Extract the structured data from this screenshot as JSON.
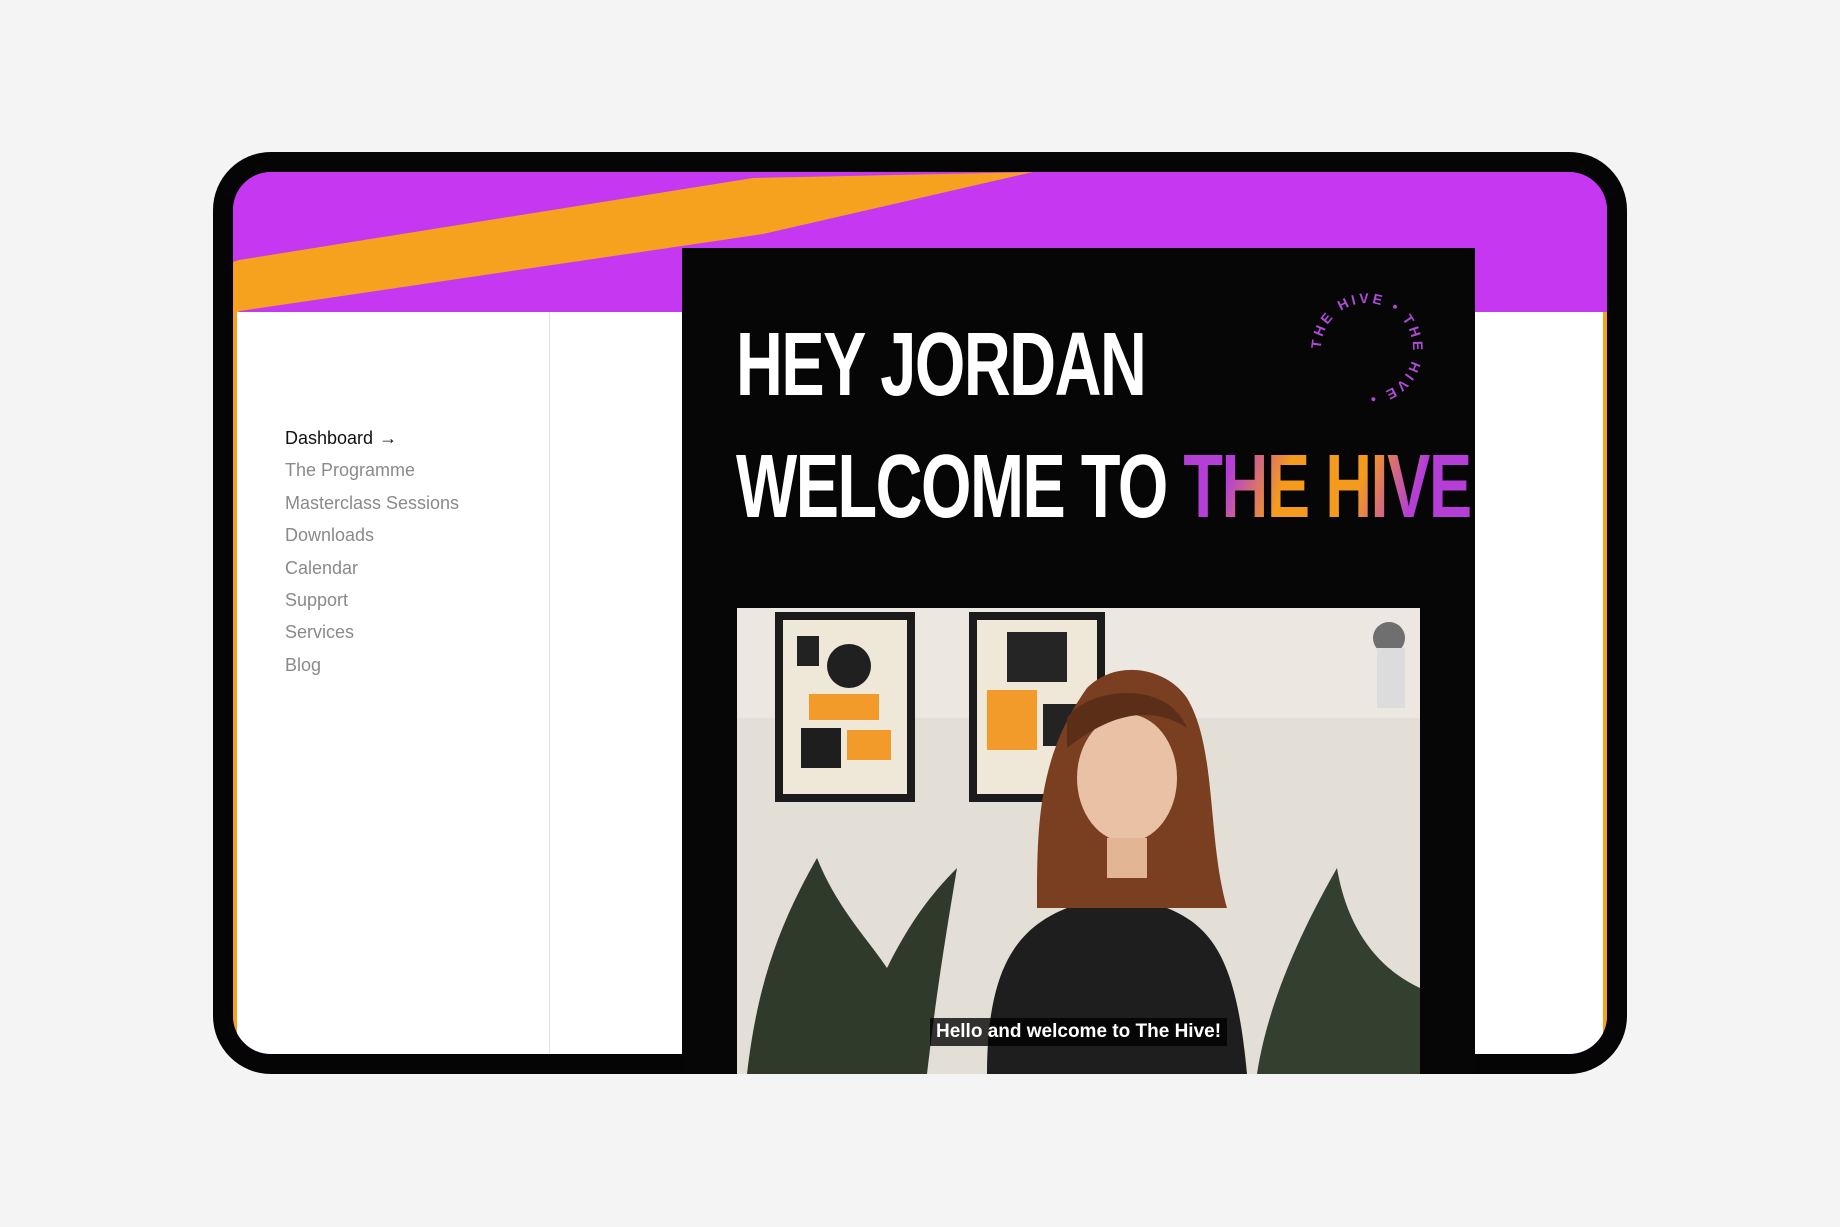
{
  "colors": {
    "accent_purple": "#c637f2",
    "accent_orange": "#f7a21f",
    "hero_background": "#060606",
    "nav_active": "#111111",
    "nav_inactive": "#8a8a8a"
  },
  "sidebar": {
    "items": [
      {
        "label": "Dashboard",
        "active": true,
        "trailing_icon": "arrow-right-icon"
      },
      {
        "label": "The Programme",
        "active": false
      },
      {
        "label": "Masterclass Sessions",
        "active": false
      },
      {
        "label": "Downloads",
        "active": false
      },
      {
        "label": "Calendar",
        "active": false
      },
      {
        "label": "Support",
        "active": false
      },
      {
        "label": "Services",
        "active": false
      },
      {
        "label": "Blog",
        "active": false
      }
    ],
    "arrow_glyph": "→"
  },
  "hero": {
    "greeting": "HEY JORDAN",
    "welcome_prefix": "WELCOME TO ",
    "welcome_brand": "THE HIVE",
    "badge_text": "THE HIVE • THE HIVE • "
  },
  "video": {
    "caption": "Hello and welcome to The Hive!"
  }
}
